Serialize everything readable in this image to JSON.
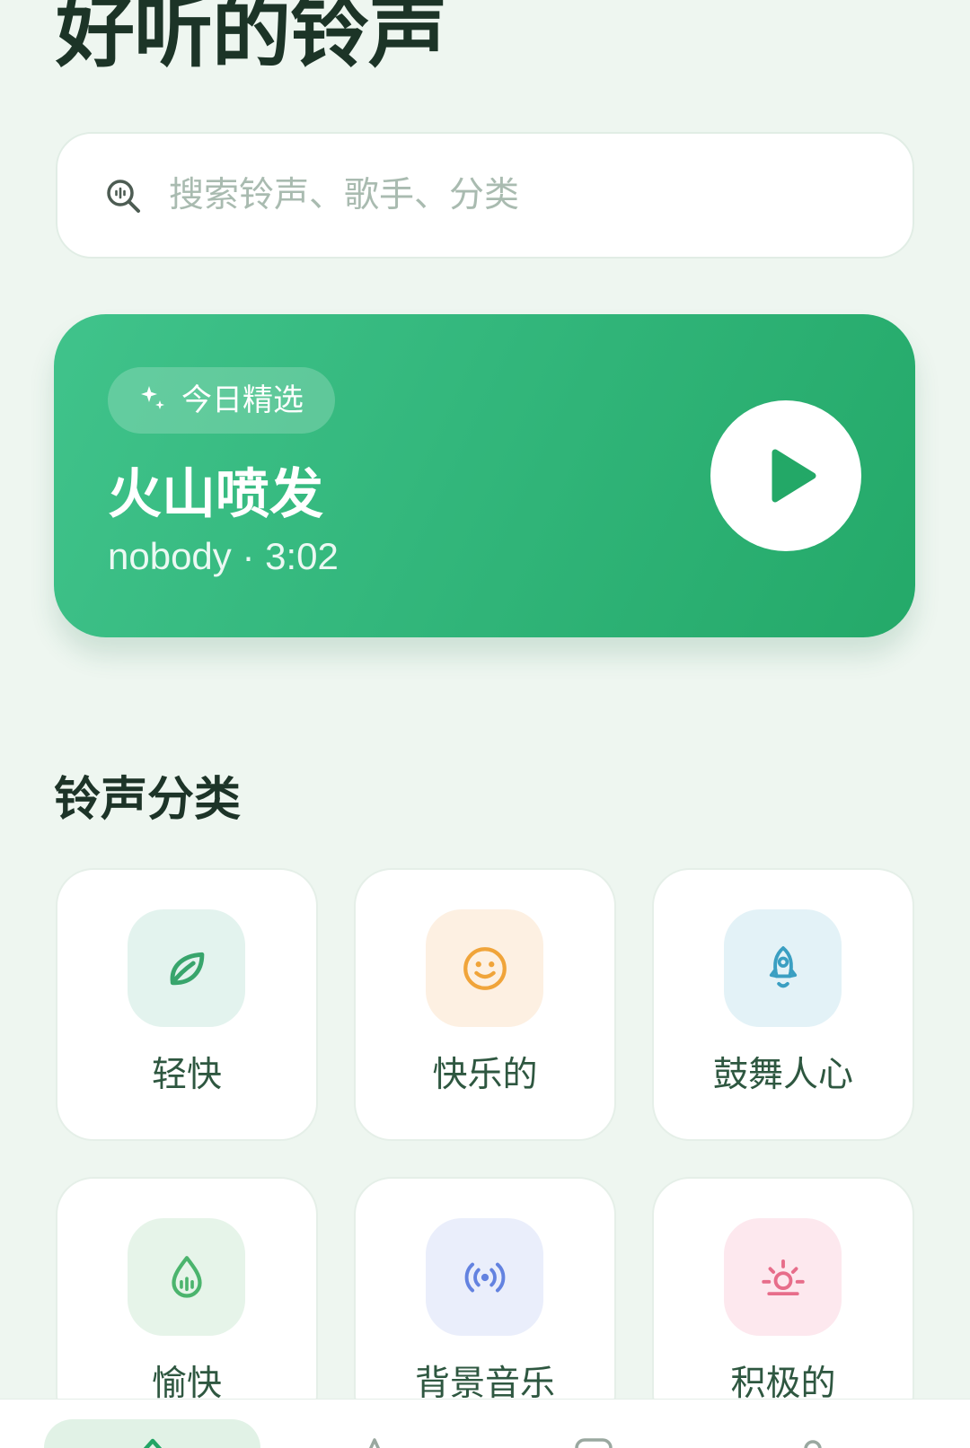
{
  "header": {
    "title": "好听的铃声"
  },
  "search": {
    "placeholder": "搜索铃声、歌手、分类",
    "icon": "search-icon"
  },
  "featured": {
    "badge": "今日精选",
    "badge_icon": "sparkle-icon",
    "title": "火山喷发",
    "subtitle": "nobody · 3:02",
    "play_icon": "play-icon"
  },
  "categories": {
    "title": "铃声分类",
    "items": [
      {
        "label": "轻快",
        "icon": "leaf-icon",
        "color": "#38a56c",
        "bg": "#e3f3ee"
      },
      {
        "label": "快乐的",
        "icon": "smiley-icon",
        "color": "#f0a43a",
        "bg": "#fdf0e2"
      },
      {
        "label": "鼓舞人心",
        "icon": "rocket-icon",
        "color": "#3a9fc2",
        "bg": "#e3f2f7"
      },
      {
        "label": "愉快",
        "icon": "droplet-icon",
        "color": "#4bb46d",
        "bg": "#e6f4e9"
      },
      {
        "label": "背景音乐",
        "icon": "broadcast-icon",
        "color": "#6382e0",
        "bg": "#eaeefb"
      },
      {
        "label": "积极的",
        "icon": "sunrise-icon",
        "color": "#e76d8a",
        "bg": "#fde8ee"
      }
    ]
  },
  "bottom_nav": {
    "items": [
      {
        "icon": "home-icon",
        "active": true,
        "color": "#22a565"
      },
      {
        "icon": "discover-icon",
        "active": false,
        "color": "#9aa8a0"
      },
      {
        "icon": "library-icon",
        "active": false,
        "color": "#9aa8a0"
      },
      {
        "icon": "profile-icon",
        "active": false,
        "color": "#9aa8a0"
      }
    ]
  },
  "theme": {
    "accent": "#2bb071",
    "background": "#eef6f0",
    "card_gradient": [
      "#40c38b",
      "#24a969"
    ]
  }
}
